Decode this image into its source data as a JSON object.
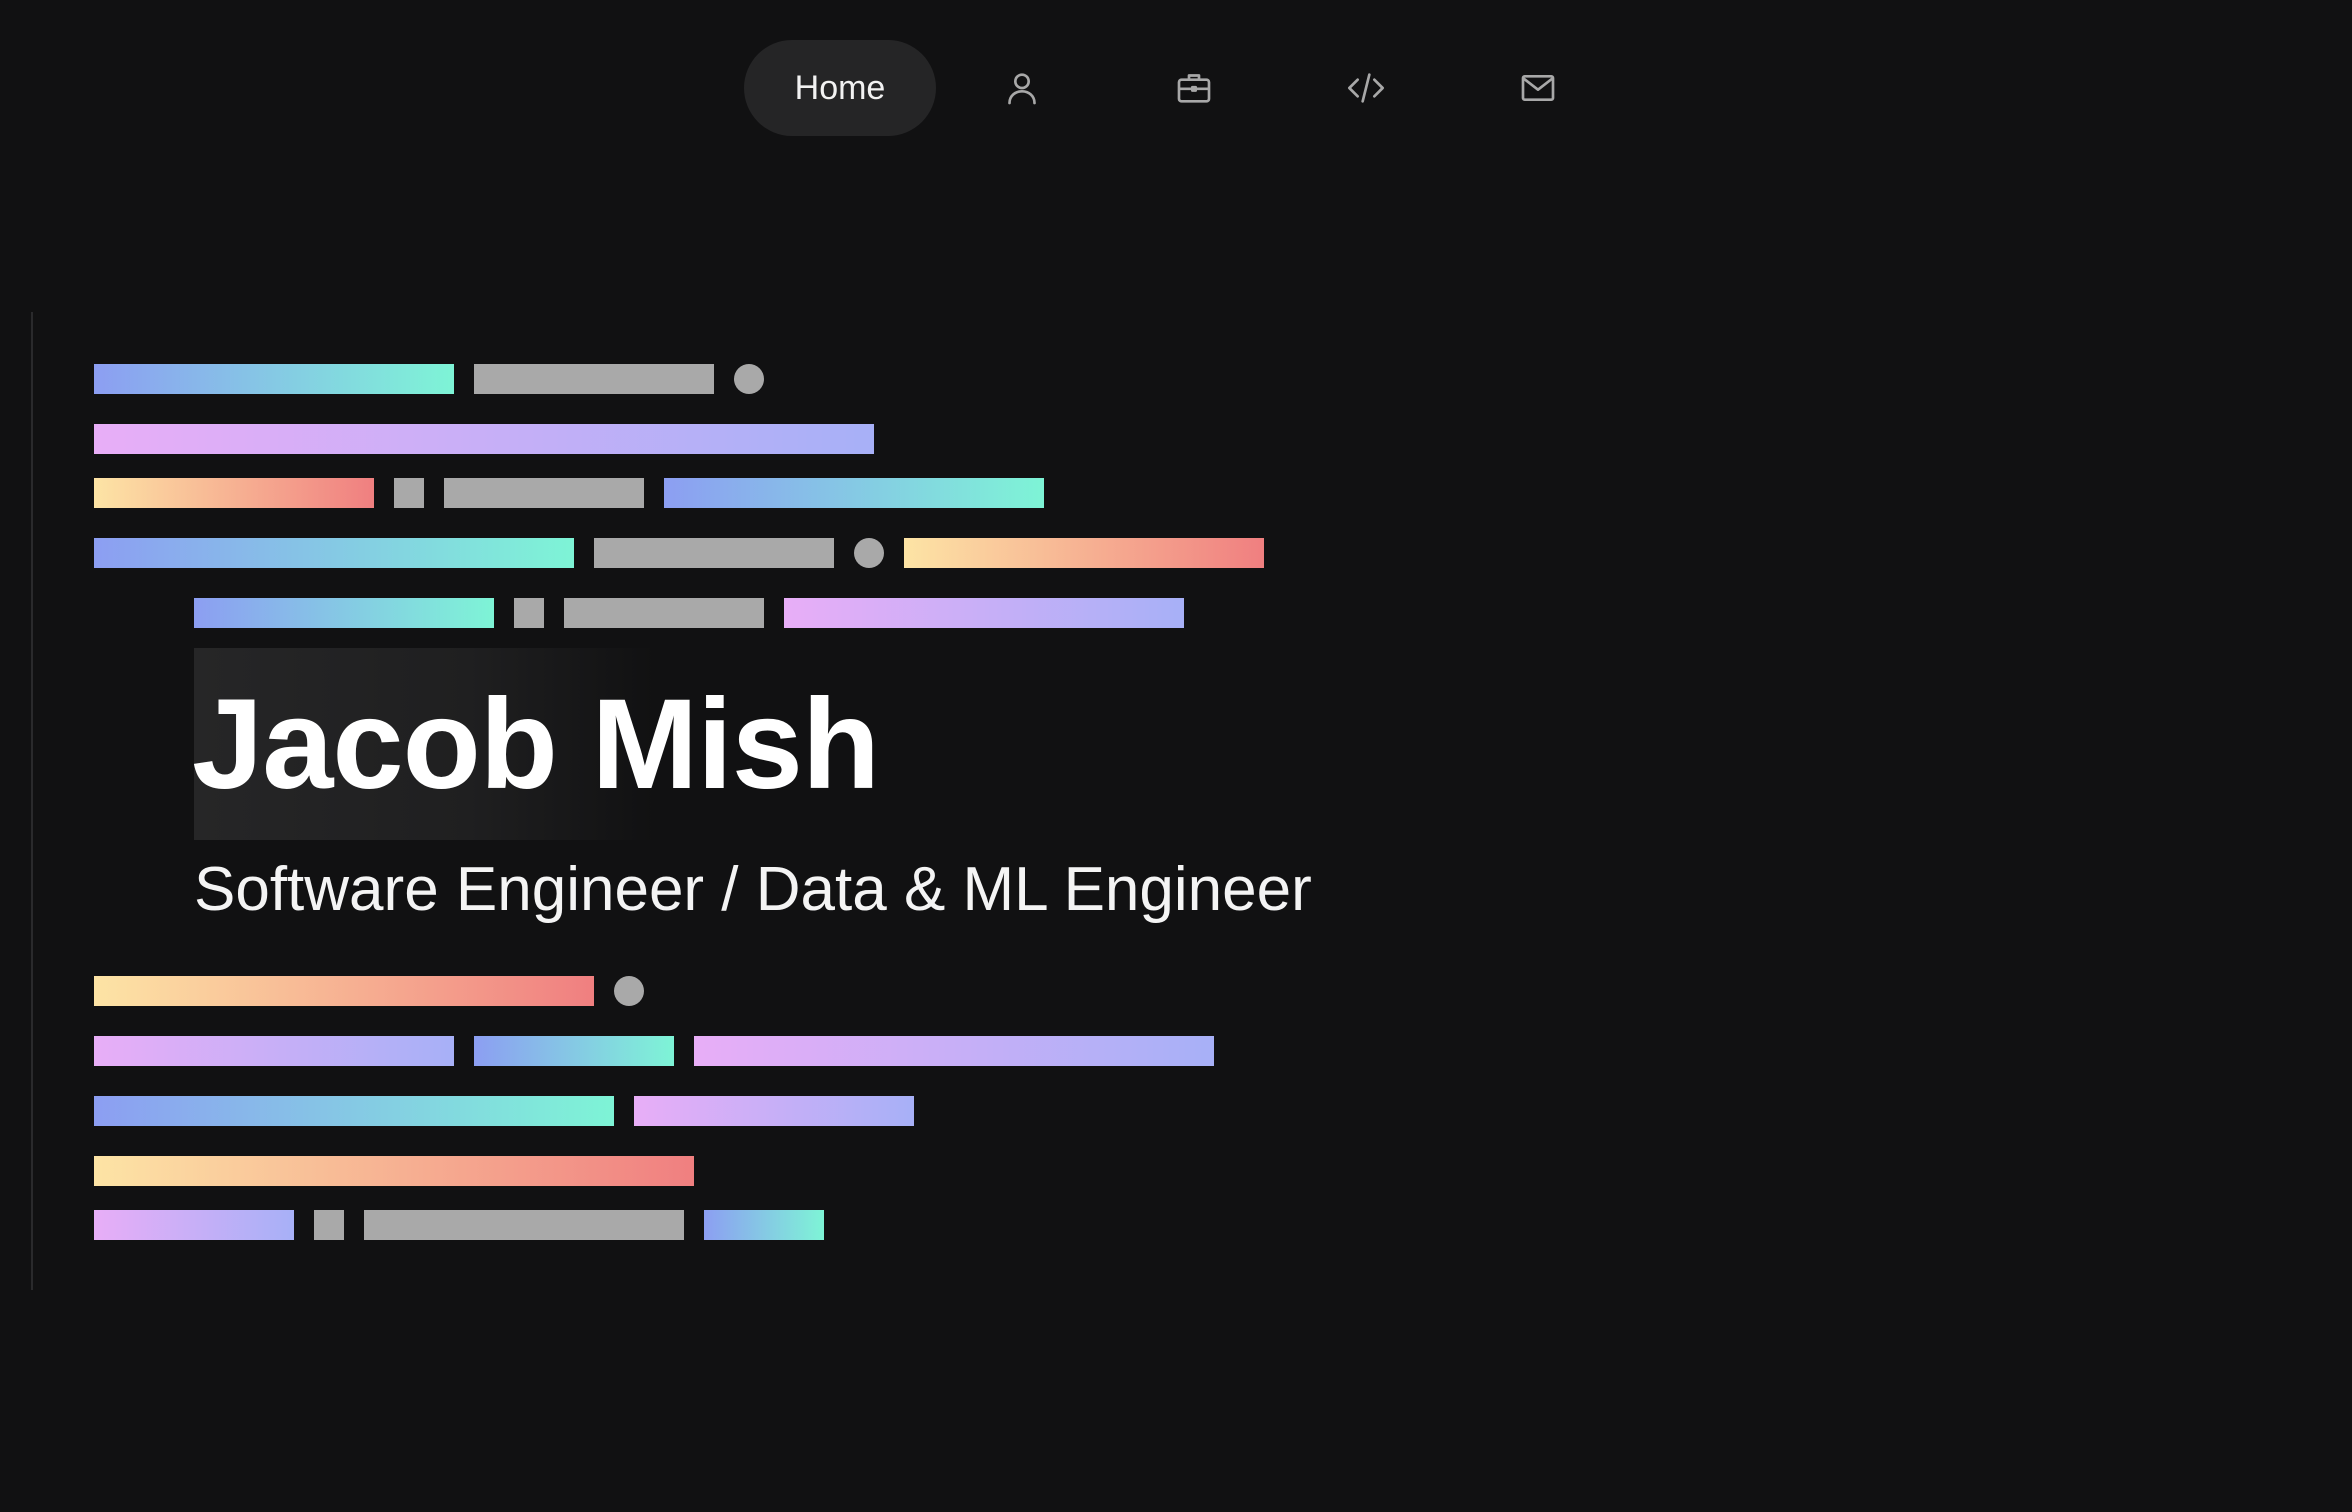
{
  "nav": {
    "home_label": "Home",
    "icons": [
      "user-icon",
      "briefcase-icon",
      "code-icon",
      "mail-icon"
    ]
  },
  "hero": {
    "name": "Jacob Mish",
    "subtitle": "Software Engineer / Data & ML Engineer"
  },
  "colors": {
    "background": "#111112",
    "nav_pill": "#252526",
    "gradient_blue": [
      "#8c9ef2",
      "#7ef4d6"
    ],
    "gradient_pink": [
      "#e8aef7",
      "#a7b0f7"
    ],
    "gradient_warm": [
      "#fde4a5",
      "#f07f80"
    ],
    "grey_block": "#a9a9a9"
  }
}
